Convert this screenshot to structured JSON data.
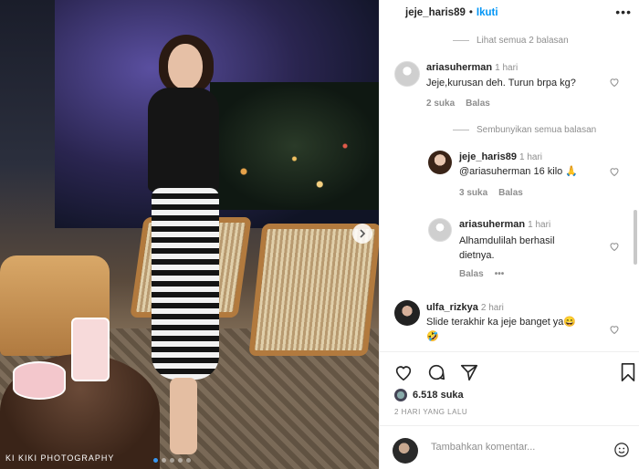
{
  "header": {
    "username": "jeje_haris89",
    "separator": "•",
    "follow_label": "Ikuti",
    "more_label": "•••"
  },
  "comments": {
    "view_replies_label": "Lihat semua 2 balasan",
    "c1": {
      "user": "ariasuherman",
      "time": "1 hari",
      "text": "Jeje,kurusan deh. Turun brpa kg?",
      "likes": "2 suka",
      "reply": "Balas"
    },
    "hide_replies_label": "Sembunyikan semua balasan",
    "r1": {
      "user": "jeje_haris89",
      "time": "1 hari",
      "text": "@ariasuherman 16 kilo 🙏",
      "likes": "3 suka",
      "reply": "Balas"
    },
    "r2": {
      "user": "ariasuherman",
      "time": "1 hari",
      "text_line1": "Alhamdulilah berhasil",
      "text_line2": "dietnya.",
      "reply": "Balas",
      "more": "•••"
    },
    "c2": {
      "user": "ulfa_rizkya",
      "time": "2 hari",
      "text": "Slide terakhir ka jeje banget ya😄",
      "emoji": "🤣"
    }
  },
  "post": {
    "likes": "6.518 suka",
    "date": "2 HARI YANG LALU",
    "add_comment_placeholder": "Tambahkan komentar...",
    "watermark": "KI KIKI PHOTOGRAPHY"
  },
  "icons": {
    "heart": "heart-icon",
    "comment": "comment-icon",
    "share": "share-icon",
    "bookmark": "bookmark-icon",
    "emoji": "emoji-icon",
    "next": "chevron-right-icon"
  },
  "colors": {
    "follow": "#0095f6",
    "muted": "#8e8e8e",
    "text": "#262626"
  }
}
